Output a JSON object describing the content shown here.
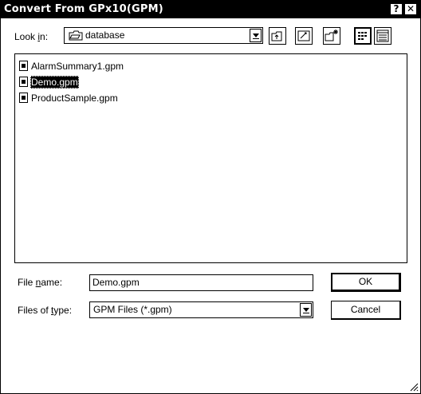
{
  "dialog": {
    "title": "Convert From GPx10(GPM)",
    "help_glyph": "?",
    "close_glyph": "✕"
  },
  "look_in": {
    "label_prefix": "Look ",
    "label_accel": "i",
    "label_suffix": "n:",
    "value": "database",
    "folder_icon": "folder-icon"
  },
  "toolbar": {
    "buttons": [
      "up-one-level-icon",
      "desktop-icon",
      "new-folder-icon",
      "list-view-icon",
      "details-view-icon"
    ]
  },
  "files": [
    {
      "name": "AlarmSummary1.gpm",
      "icon": "gpm-file-icon",
      "selected": false
    },
    {
      "name": "Demo.gpm",
      "icon": "gpm-file-icon",
      "selected": true
    },
    {
      "name": "ProductSample.gpm",
      "icon": "gpm-file-icon",
      "selected": false
    }
  ],
  "file_name": {
    "label_prefix": "File ",
    "label_accel": "n",
    "label_suffix": "ame:",
    "value": "Demo.gpm"
  },
  "files_of_type": {
    "label_prefix": "Files of ",
    "label_accel": "t",
    "label_suffix": "ype:",
    "value": "GPM Files (*.gpm)"
  },
  "buttons": {
    "ok": "OK",
    "cancel": "Cancel"
  }
}
